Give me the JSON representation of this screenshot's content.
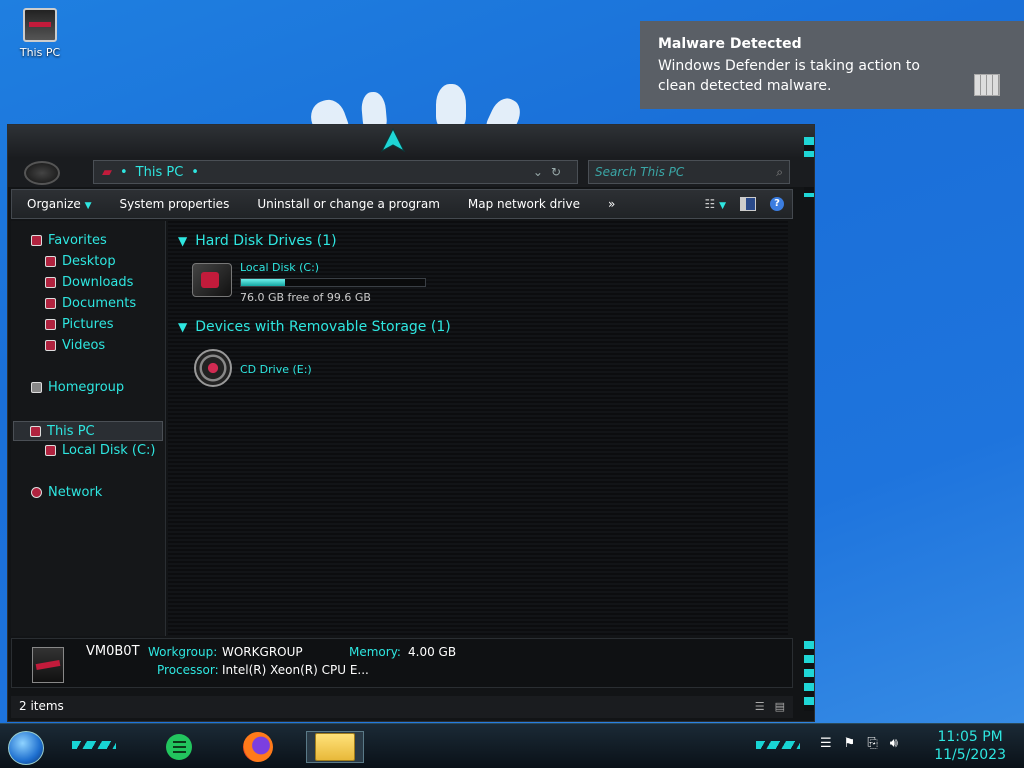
{
  "desktop": {
    "icon_label": "This PC"
  },
  "toast": {
    "title": "Malware Detected",
    "body": "Windows Defender is taking action to clean detected malware."
  },
  "explorer": {
    "address_text": "This PC",
    "search_placeholder": "Search This PC",
    "toolbar": {
      "organize": "Organize",
      "system_properties": "System properties",
      "uninstall": "Uninstall or change a program",
      "map_drive": "Map network drive",
      "more": "»",
      "help": "?"
    },
    "nav": {
      "favorites": "Favorites",
      "desktop": "Desktop",
      "downloads": "Downloads",
      "documents": "Documents",
      "pictures": "Pictures",
      "videos": "Videos",
      "homegroup": "Homegroup",
      "this_pc": "This PC",
      "local_disk": "Local Disk (C:)",
      "network": "Network"
    },
    "groups": {
      "hdd": "Hard Disk Drives (1)",
      "removable": "Devices with Removable Storage (1)"
    },
    "drives": {
      "local_name": "Local Disk (C:)",
      "local_free": "76.0 GB free of 99.6 GB",
      "local_used_fraction": 0.237,
      "cd_name": "CD Drive (E:)"
    },
    "details": {
      "computer_name": "VM0B0T",
      "workgroup_label": "Workgroup:",
      "workgroup_value": "WORKGROUP",
      "memory_label": "Memory:",
      "memory_value": "4.00 GB",
      "processor_label": "Processor:",
      "processor_value": "Intel(R) Xeon(R) CPU E..."
    },
    "status": {
      "items": "2 items"
    }
  },
  "taskbar": {
    "time": "11:05 PM",
    "date": "11/5/2023"
  }
}
